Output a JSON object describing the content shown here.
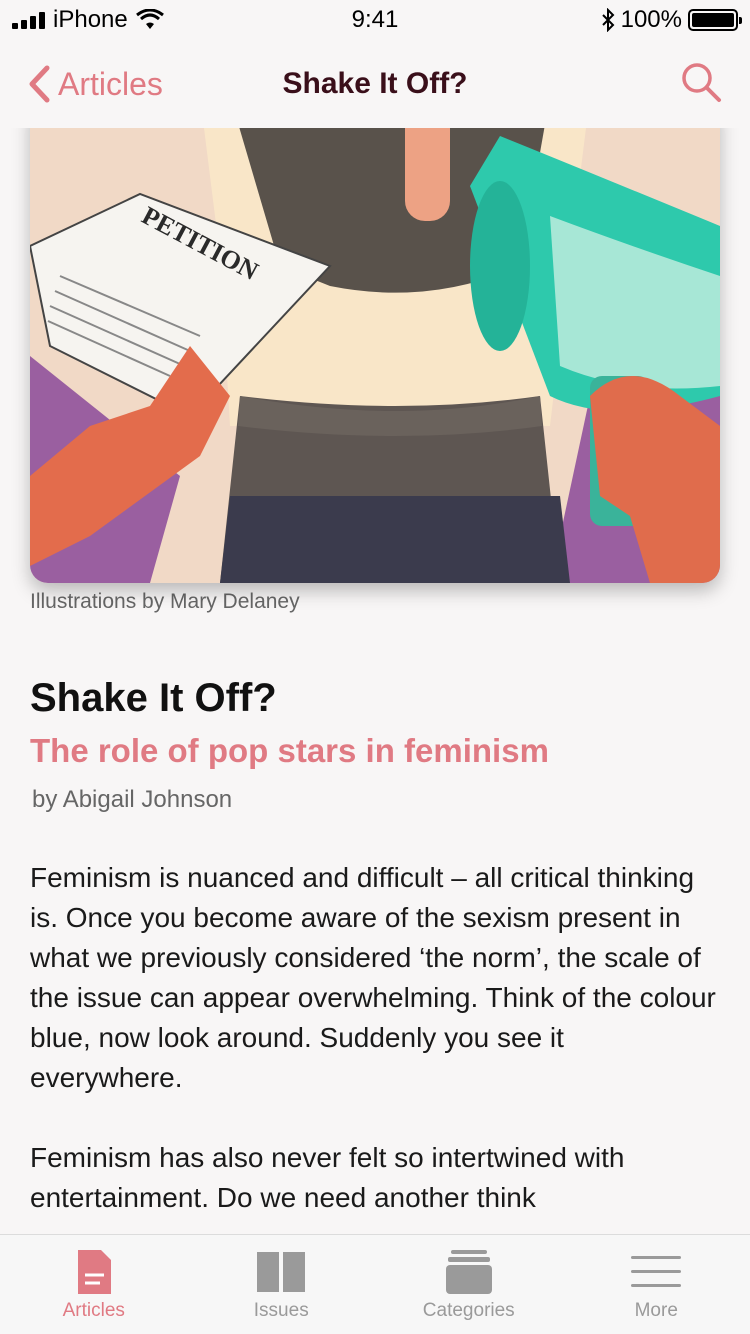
{
  "status_bar": {
    "carrier": "iPhone",
    "time": "9:41",
    "battery": "100%"
  },
  "nav": {
    "back_label": "Articles",
    "title": "Shake It Off?"
  },
  "hero": {
    "caption": "Illustrations by Mary Delaney",
    "petition_text": "PETITION"
  },
  "article": {
    "title": "Shake It Off?",
    "subtitle": "The role of pop stars in feminism",
    "byline": "by Abigail Johnson",
    "paragraphs": [
      "Feminism is nuanced and difficult – all critical thinking is. Once you become aware of the sexism present in what we previously considered ‘the norm’, the scale of the issue can appear overwhelming. Think of the colour blue, now look around. Suddenly you see it everywhere.",
      "Feminism has also never felt so intertwined with entertainment. Do we need another think"
    ]
  },
  "tabs": [
    {
      "label": "Articles",
      "icon": "document-icon",
      "active": true
    },
    {
      "label": "Issues",
      "icon": "book-icon",
      "active": false
    },
    {
      "label": "Categories",
      "icon": "stack-icon",
      "active": false
    },
    {
      "label": "More",
      "icon": "menu-icon",
      "active": false
    }
  ],
  "colors": {
    "accent": "#e07a83",
    "title_dark": "#3a0f1a",
    "tab_inactive": "#9a9a9a"
  }
}
